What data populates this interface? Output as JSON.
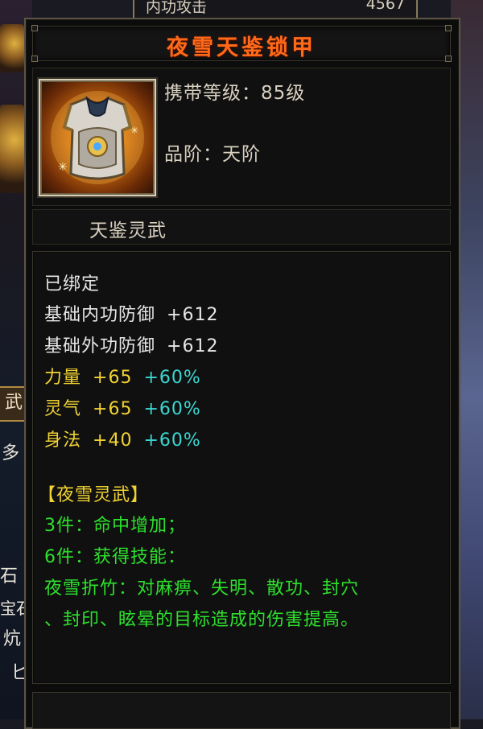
{
  "background": {
    "top_stat": {
      "label": "内功攻击",
      "value": "4567"
    },
    "left_glyphs": [
      "武",
      "多",
      "石",
      "宝石",
      "炕",
      "匕"
    ]
  },
  "item": {
    "name": "夜雪天鉴锁甲",
    "icon": "armor-vest-icon",
    "carry_level": "携带等级：85级",
    "rank": "品阶：天阶",
    "series": "天鉴灵武"
  },
  "properties": {
    "bound": "已绑定",
    "base_stats": [
      {
        "label": "基础内功防御",
        "value": "+612"
      },
      {
        "label": "基础外功防御",
        "value": "+612"
      }
    ],
    "attributes": [
      {
        "label": "力量",
        "value": "+65",
        "bonus": "+60%"
      },
      {
        "label": "灵气",
        "value": "+65",
        "bonus": "+60%"
      },
      {
        "label": "身法",
        "value": "+40",
        "bonus": "+60%"
      }
    ]
  },
  "set_bonus": {
    "name": "【夜雪灵武】",
    "pieces": [
      "3件：命中增加；",
      "6件：获得技能："
    ],
    "skill_line1": "夜雪折竹：对麻痹、失明、散功、封穴",
    "skill_line2": "、封印、眩晕的目标造成的伤害提高。"
  },
  "colors": {
    "title": "#ff6a1a",
    "stat_white": "#e6e6e6",
    "attribute_yellow": "#f0d232",
    "bonus_cyan": "#3ad6d0",
    "set_green": "#2ee02e"
  }
}
